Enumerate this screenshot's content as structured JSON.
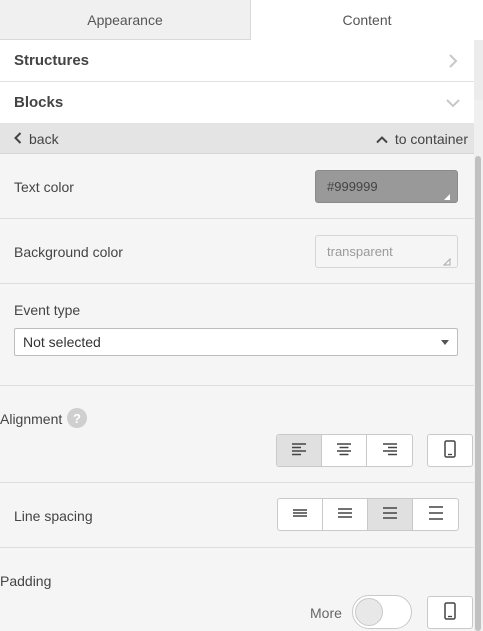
{
  "tabs": {
    "appearance": "Appearance",
    "content": "Content",
    "active": "Content"
  },
  "sections": {
    "structures": "Structures",
    "blocks": "Blocks"
  },
  "nav": {
    "back": "back",
    "to_container": "to container"
  },
  "text_color": {
    "label": "Text color",
    "value": "#999999"
  },
  "background_color": {
    "label": "Background color",
    "value": "transparent"
  },
  "event_type": {
    "label": "Event type",
    "selected": "Not selected"
  },
  "alignment": {
    "label": "Alignment",
    "help": "?",
    "selected": "left"
  },
  "line_spacing": {
    "label": "Line spacing",
    "selected": 3
  },
  "padding": {
    "label": "Padding",
    "more_label": "More",
    "more_enabled": false
  },
  "icons": [
    "chevron-right-icon",
    "chevron-down-icon",
    "chevron-left-icon",
    "chevron-up-icon",
    "align-left-icon",
    "align-center-icon",
    "align-right-icon",
    "mobile-icon",
    "line-spacing-icon"
  ]
}
